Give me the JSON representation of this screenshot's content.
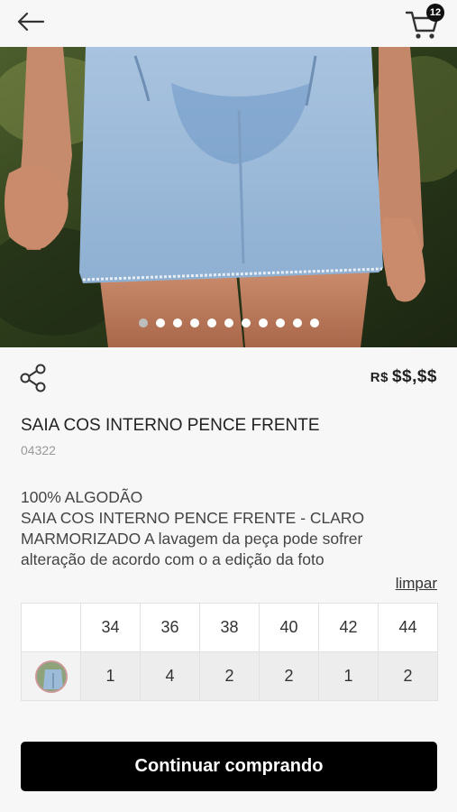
{
  "header": {
    "cart_count": "12"
  },
  "gallery": {
    "image_count": 11,
    "active_index": 0
  },
  "product": {
    "currency": "R$",
    "price": "$$,$$",
    "title": "SAIA COS INTERNO PENCE FRENTE",
    "sku": "04322",
    "description_lines": [
      "100% ALGODÃO",
      "SAIA COS INTERNO PENCE FRENTE - CLARO",
      "MARMORIZADO A lavagem da peça pode sofrer",
      "alteração de acordo com o a edição da foto"
    ]
  },
  "grid": {
    "clear_label": "limpar",
    "sizes": [
      "34",
      "36",
      "38",
      "40",
      "42",
      "44"
    ],
    "quantities": [
      "1",
      "4",
      "2",
      "2",
      "1",
      "2"
    ]
  },
  "actions": {
    "continue_label": "Continuar comprando"
  },
  "icons": {
    "back": "back-arrow-icon",
    "cart": "cart-icon",
    "share": "share-icon"
  }
}
